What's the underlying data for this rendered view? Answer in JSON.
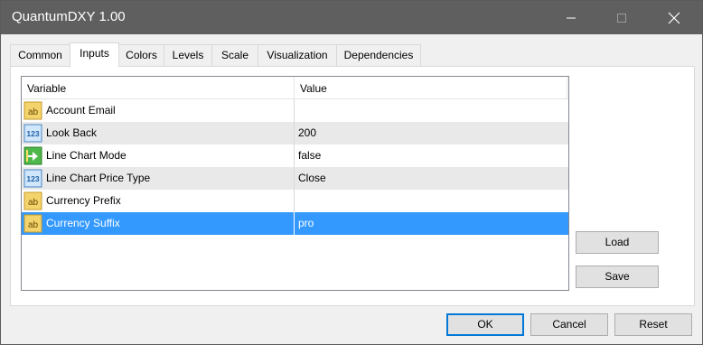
{
  "window": {
    "title": "QuantumDXY 1.00"
  },
  "tabs": [
    {
      "label": "Common"
    },
    {
      "label": "Inputs"
    },
    {
      "label": "Colors"
    },
    {
      "label": "Levels"
    },
    {
      "label": "Scale"
    },
    {
      "label": "Visualization"
    },
    {
      "label": "Dependencies"
    }
  ],
  "active_tab": "Inputs",
  "grid": {
    "headers": {
      "variable": "Variable",
      "value": "Value"
    },
    "rows": [
      {
        "variable": "Account Email",
        "value": "",
        "icon": "string-ab-icon"
      },
      {
        "variable": "Look Back",
        "value": "200",
        "icon": "integer-123-icon"
      },
      {
        "variable": "Line Chart Mode",
        "value": "false",
        "icon": "boolean-icon"
      },
      {
        "variable": "Line Chart Price Type",
        "value": "Close",
        "icon": "integer-123-icon"
      },
      {
        "variable": "Currency Prefix",
        "value": "",
        "icon": "string-ab-icon"
      },
      {
        "variable": "Currency Suffix",
        "value": "pro",
        "icon": "string-ab-icon",
        "selected": true
      }
    ]
  },
  "side_buttons": {
    "load": "Load",
    "save": "Save"
  },
  "footer_buttons": {
    "ok": "OK",
    "cancel": "Cancel",
    "reset": "Reset"
  },
  "colors": {
    "titlebar": "#5f5f5f",
    "selection": "#3399ff",
    "default_button_border": "#0078d7"
  }
}
